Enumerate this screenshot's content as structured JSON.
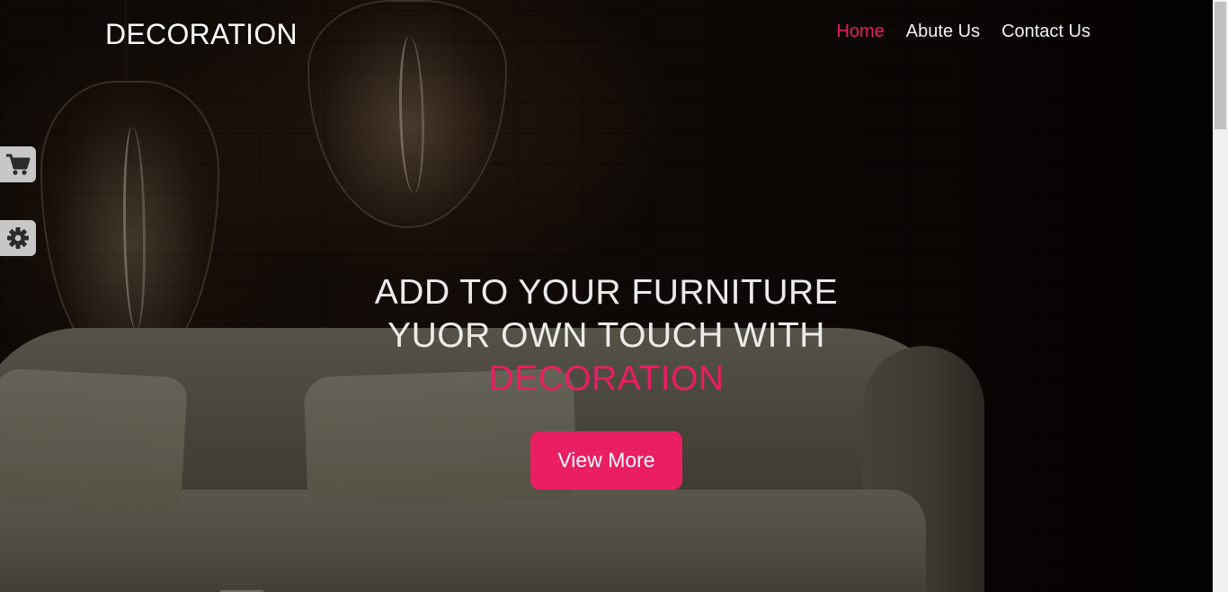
{
  "header": {
    "brand": "DECORATION",
    "nav": [
      {
        "label": "Home",
        "active": true
      },
      {
        "label": "Abute Us",
        "active": false
      },
      {
        "label": "Contact Us",
        "active": false
      }
    ]
  },
  "side_widgets": [
    {
      "icon": "cart-icon"
    },
    {
      "icon": "gear-icon"
    }
  ],
  "hero": {
    "line1": "ADD TO YOUR FURNITURE",
    "line2": "YUOR OWN TOUCH WITH",
    "line3": "DECORATION",
    "button": "View More"
  },
  "colors": {
    "accent": "#e91e63",
    "text": "#ffffff",
    "widget_bg": "#c7c7c7"
  }
}
